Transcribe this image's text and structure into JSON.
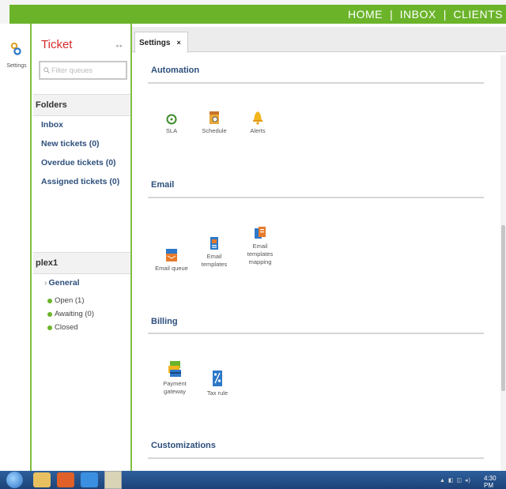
{
  "topnav": {
    "home": "HOME",
    "inbox": "INBOX",
    "clients": "CLIENTS",
    "sep": "|"
  },
  "left_rail": {
    "label": "Settings",
    "icon": "gear-cog-icon"
  },
  "ticket_panel": {
    "title": "Ticket",
    "arrows": "◂ ▸",
    "search_placeholder": "Filter queues",
    "folders_heading": "Folders",
    "folders": [
      "Inbox",
      "New tickets (0)",
      "Overdue tickets (0)",
      "Assigned tickets (0)"
    ],
    "queue_heading": "plex1",
    "group_label": "General",
    "group_prefix": "›",
    "statuses": [
      "Open (1)",
      "Awaiting (0)",
      "Closed"
    ]
  },
  "tab": {
    "label": "Settings",
    "close": "×"
  },
  "sections": {
    "automation": {
      "title": "Automation",
      "items": [
        "SLA",
        "Schedule",
        "Alerts"
      ]
    },
    "email": {
      "title": "Email",
      "items": [
        "Email queue",
        "Email templates",
        "Email templates mapping"
      ]
    },
    "billing": {
      "title": "Billing",
      "items": [
        "Payment gateway",
        "Tax rule"
      ]
    },
    "customizations": {
      "title": "Customizations"
    }
  },
  "taskbar": {
    "clock": "4:30 PM",
    "tray": "▲ ◧ ◫ ◂)"
  },
  "colors": {
    "brand_green": "#6bb42a",
    "link_blue": "#2d4f7c",
    "title_red": "#d42c2c"
  }
}
